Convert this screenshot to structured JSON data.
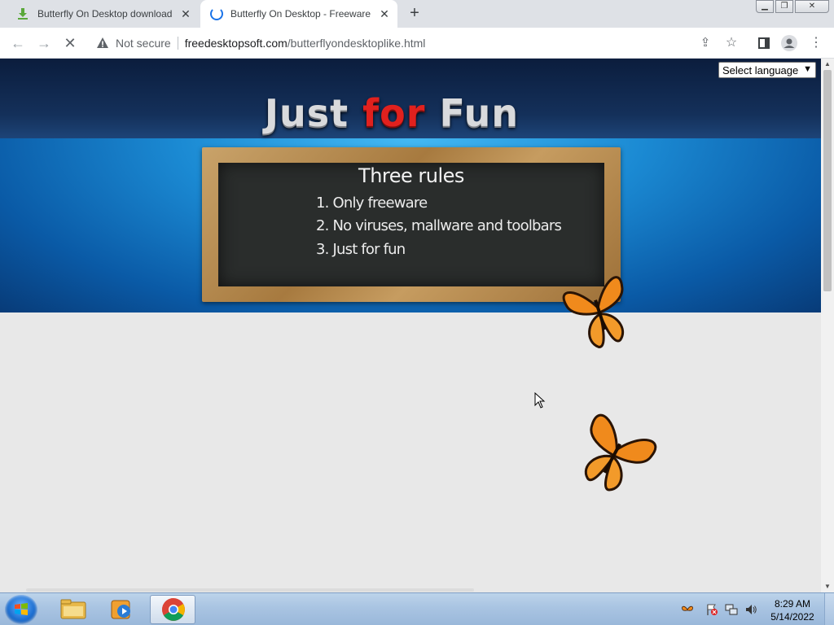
{
  "browser": {
    "tabs": [
      {
        "title": "Butterfly On Desktop download (",
        "state": "inactive",
        "icon": "download-icon"
      },
      {
        "title": "Butterfly On Desktop - Freeware",
        "state": "active-loading",
        "icon": "loading-spinner-icon"
      }
    ],
    "new_tab_label": "+",
    "security_label": "Not secure",
    "url_host": "freedesktopsoft.com",
    "url_path": "/butterflyondesktoplike.html"
  },
  "page": {
    "language_select": {
      "selected": "Select language"
    },
    "headline": {
      "word1": "Just",
      "word2": "for",
      "word3": "Fun"
    },
    "board": {
      "title": "Three rules",
      "rules": [
        "1. Only freeware",
        "2. No viruses, mallware and toolbars",
        "3. Just for fun"
      ]
    }
  },
  "taskbar": {
    "clock_time": "8:29 AM",
    "clock_date": "5/14/2022",
    "pinned": [
      "windows-explorer-icon",
      "media-player-icon",
      "chrome-icon"
    ]
  },
  "colors": {
    "accent_blue": "#1a73e8",
    "headline_red": "#e1211e",
    "banner_blue": "#1b8ad3",
    "butterfly_orange": "#f08a1c"
  }
}
